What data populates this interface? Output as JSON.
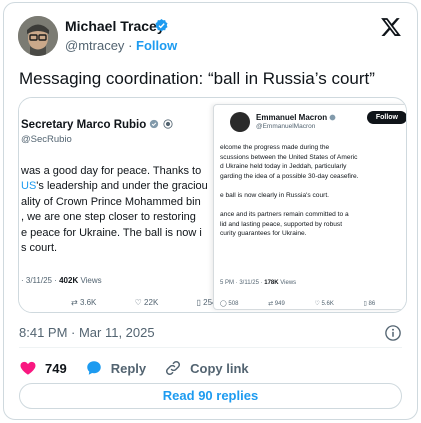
{
  "author": {
    "name": "Michael Tracey",
    "handle": "@mtracey",
    "separator": "·",
    "follow_label": "Follow"
  },
  "tweet": {
    "text": "Messaging coordination: “ball in Russia’s court”",
    "timestamp": "8:41 PM · Mar 11, 2025"
  },
  "left_screenshot": {
    "name": "Secretary Marco Rubio",
    "handle": "@SecRubio",
    "lines": [
      "was a good day for peace. Thanks to",
      "US",
      "'s leadership and under the graciou",
      "ality of Crown Prince Mohammed bin",
      ", we are one step closer to restoring",
      "e peace for Ukraine.  The ball is now i",
      "s court."
    ],
    "meta_prefix": "· 3/11/25 · ",
    "views_count": "402K",
    "views_label": " Views",
    "retweets": "3.6K",
    "likes": "22K",
    "bookmarks": "254"
  },
  "right_screenshot": {
    "name": "Emmanuel Macron",
    "handle": "@EmmanuelMacron",
    "follow_label": "Follow",
    "lines": [
      "elcome the progress made during the",
      "scussions between the United States of Americ",
      "d Ukraine held today in Jeddah, particularly",
      "garding the idea of a possible 30-day ceasefire.",
      "",
      "e ball is now clearly in Russia's court.",
      "",
      "ance and its partners remain committed to a",
      "lid and lasting peace, supported by robust",
      "curity guarantees for Ukraine."
    ],
    "meta_prefix": "5 PM · 3/11/25 · ",
    "views_count": "178K",
    "views_label": " Views",
    "replies": "508",
    "retweets": "949",
    "likes": "5.6K",
    "bookmarks": "86"
  },
  "engagement": {
    "likes": "749",
    "reply_label": "Reply",
    "copy_link_label": "Copy link",
    "read_replies_label": "Read 90 replies"
  },
  "colors": {
    "accent": "#1d9bf0",
    "like": "#f91880",
    "text": "#0f1419",
    "secondary": "#536471",
    "border": "#cfd9de"
  },
  "icons": [
    "verified-badge-icon",
    "x-logo-icon",
    "info-icon",
    "heart-icon",
    "reply-bubble-icon",
    "link-icon",
    "retweet-icon",
    "bookmark-icon"
  ]
}
